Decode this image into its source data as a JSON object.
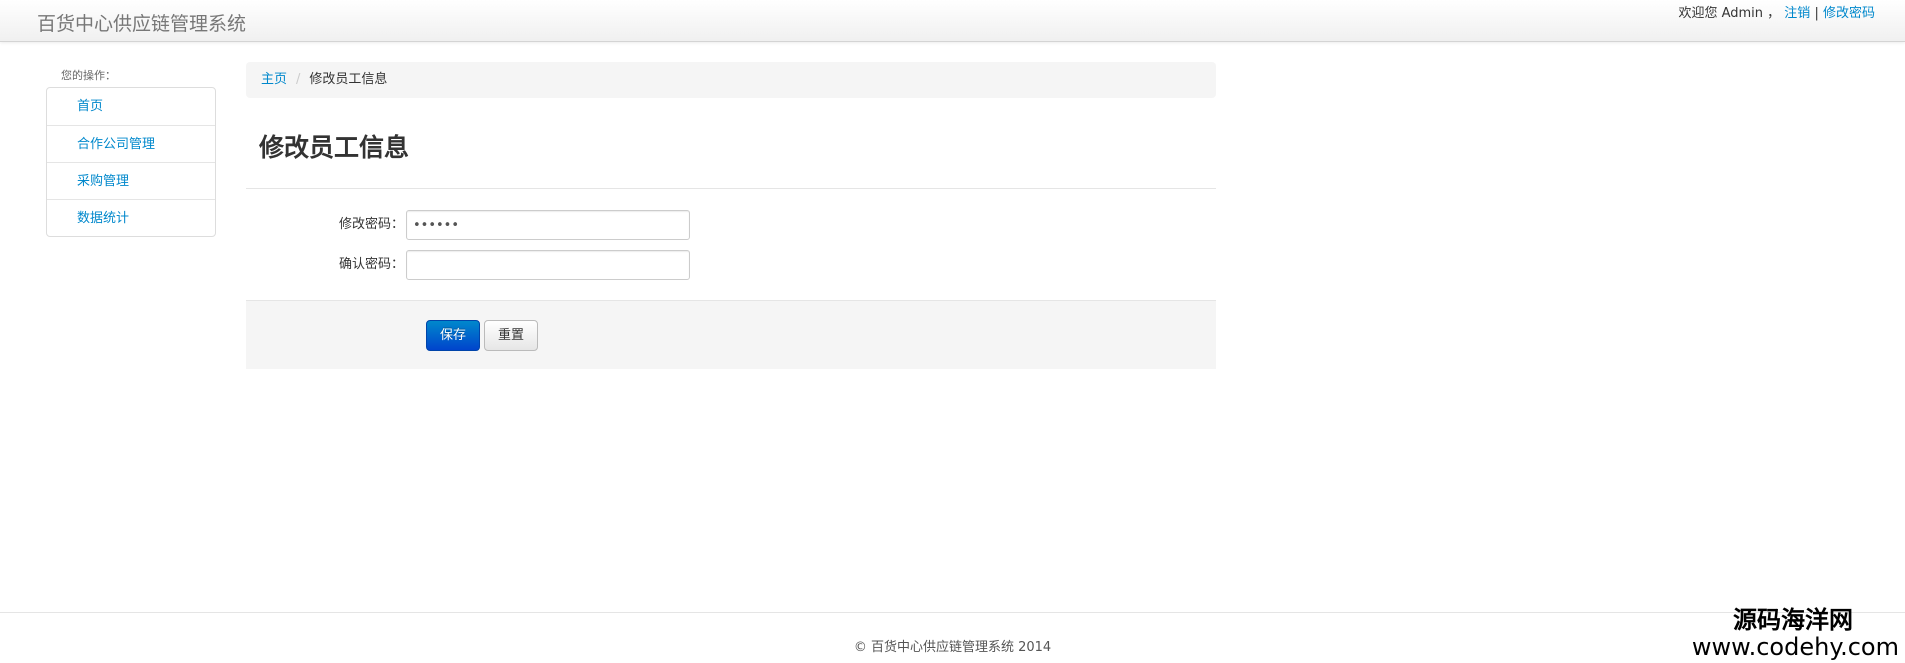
{
  "navbar": {
    "brand": "百货中心供应链管理系统",
    "welcome": "欢迎您 Admin ，",
    "logout": "注销",
    "separator": "|",
    "change_password": "修改密码"
  },
  "sidebar": {
    "title": "您的操作：",
    "items": [
      {
        "label": "首页"
      },
      {
        "label": "合作公司管理"
      },
      {
        "label": "采购管理"
      },
      {
        "label": "数据统计"
      }
    ]
  },
  "breadcrumb": {
    "home": "主页",
    "divider": "/",
    "current": "修改员工信息"
  },
  "page": {
    "title": "修改员工信息"
  },
  "form": {
    "password_label": "修改密码：",
    "password_value": "••••••",
    "confirm_label": "确认密码：",
    "confirm_value": ""
  },
  "actions": {
    "save": "保存",
    "reset": "重置"
  },
  "footer": {
    "text": "© 百货中心供应链管理系统 2014"
  },
  "watermark": {
    "cn": "源码海洋网",
    "url": "www.codehy.com"
  },
  "colors": {
    "link": "#0088cc",
    "primary_button": "#0055cc"
  }
}
